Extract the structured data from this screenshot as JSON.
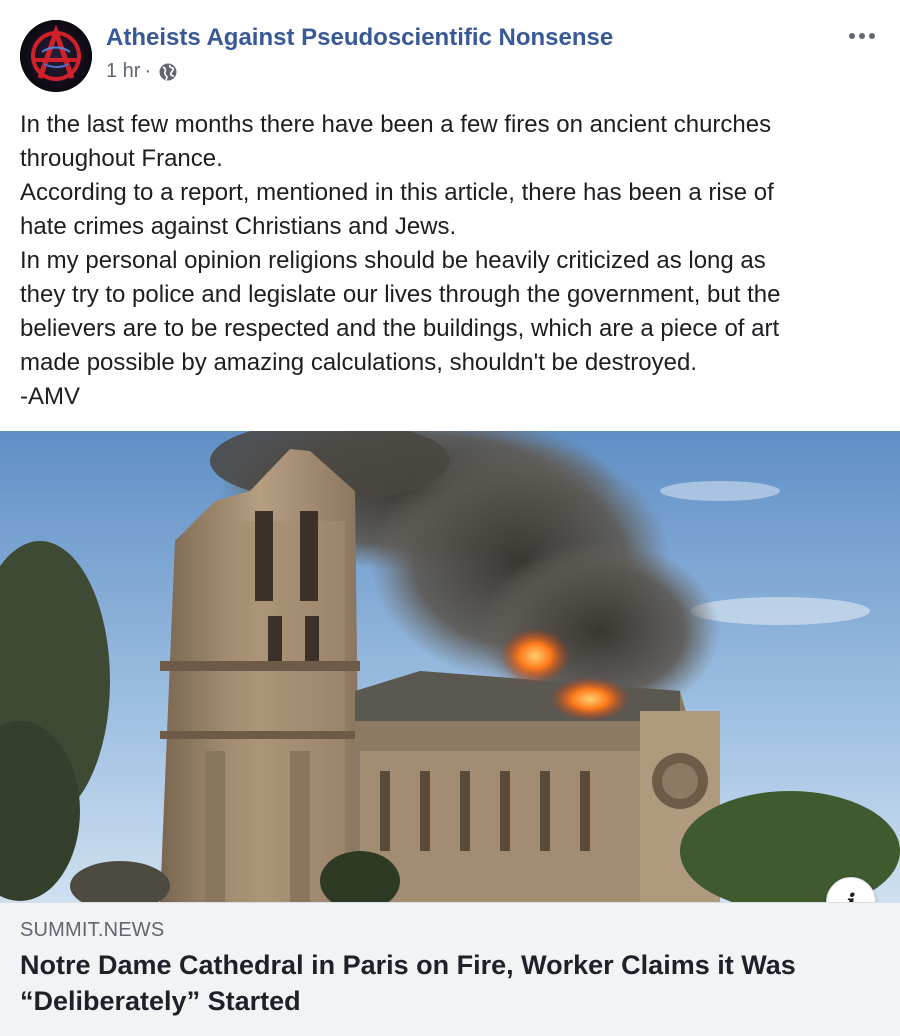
{
  "post": {
    "page_name": "Atheists Against Pseudoscientific Nonsense",
    "timestamp": "1 hr",
    "separator": "·",
    "privacy_icon": "globe-icon",
    "more_icon": "more-options-icon",
    "avatar_icon": "anarchy-symbol-avatar",
    "text_lines": [
      "In the last few months there have been a few fires on ancient churches",
      "throughout France.",
      "According to a report, mentioned in this article, there has been a rise of",
      "hate crimes against Christians and Jews.",
      "In my personal opinion religions should be heavily criticized as long as",
      "they try to police and legislate our lives through the government, but the",
      "believers are to be respected and the buildings, which are a piece of art",
      "made possible by amazing calculations, shouldn't be destroyed.",
      "-AMV"
    ]
  },
  "link": {
    "domain": "SUMMIT.NEWS",
    "headline_line1": "Notre Dame Cathedral in Paris on Fire, Worker Claims it Was",
    "headline_line2": "“Deliberately” Started",
    "info_label": "i"
  },
  "colors": {
    "page_name": "#385898",
    "meta_text": "#606770",
    "caption_bg": "#f2f3f5"
  }
}
